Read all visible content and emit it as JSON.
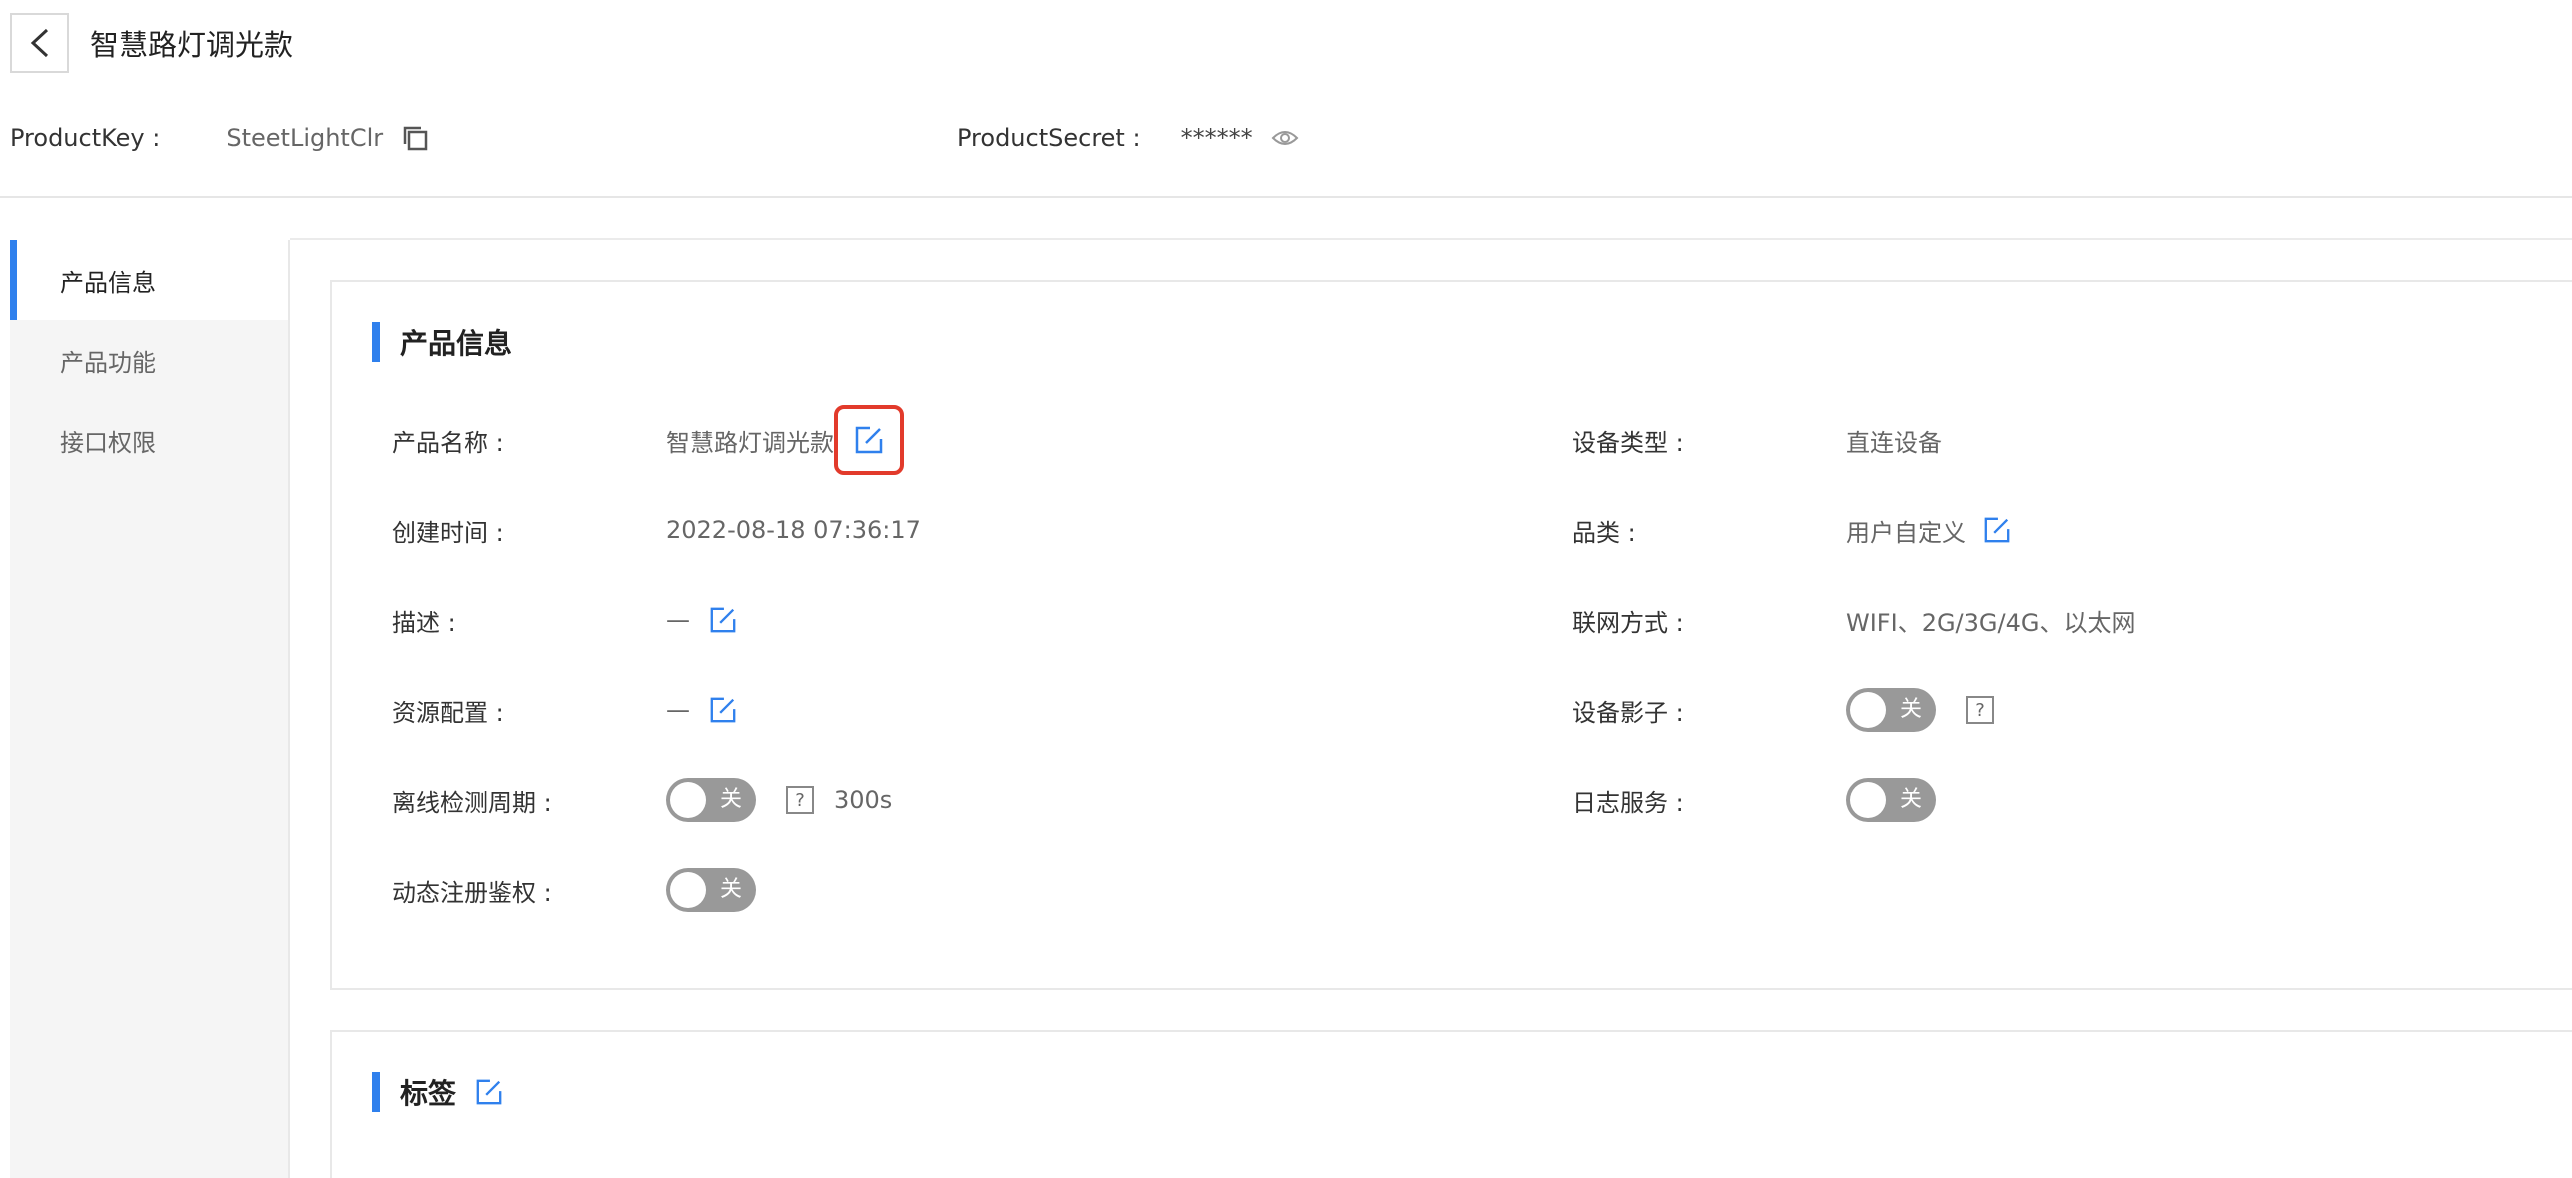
{
  "header": {
    "title": "智慧路灯调光款",
    "back_icon": "chevron-left-icon",
    "product_key_label": "ProductKey :",
    "product_key_value": "SteetLightClr",
    "product_secret_label": "ProductSecret :",
    "product_secret_value": "******"
  },
  "sidebar": {
    "items": [
      {
        "label": "产品信息",
        "active": true
      },
      {
        "label": "产品功能",
        "active": false
      },
      {
        "label": "接口权限",
        "active": false
      }
    ]
  },
  "product_info": {
    "section_title": "产品信息",
    "left": {
      "name_label": "产品名称 :",
      "name_value": "智慧路灯调光款",
      "created_label": "创建时间 :",
      "created_value": "2022-08-18 07:36:17",
      "desc_label": "描述 :",
      "desc_value": "—",
      "resource_label": "资源配置 :",
      "resource_value": "—",
      "offline_label": "离线检测周期 :",
      "offline_toggle": "关",
      "offline_value": "300s",
      "dynamic_label": "动态注册鉴权 :",
      "dynamic_toggle": "关"
    },
    "right": {
      "device_type_label": "设备类型 :",
      "device_type_value": "直连设备",
      "category_label": "品类 :",
      "category_value": "用户自定义",
      "network_label": "联网方式 :",
      "network_value": "WIFI、2G/3G/4G、以太网",
      "shadow_label": "设备影子 :",
      "shadow_toggle": "关",
      "log_label": "日志服务 :",
      "log_toggle": "关"
    },
    "help_glyph": "?"
  },
  "tags": {
    "section_title": "标签"
  },
  "colors": {
    "accent": "#2f80ed",
    "highlight": "#e23a2b",
    "toggle_off": "#999999"
  }
}
